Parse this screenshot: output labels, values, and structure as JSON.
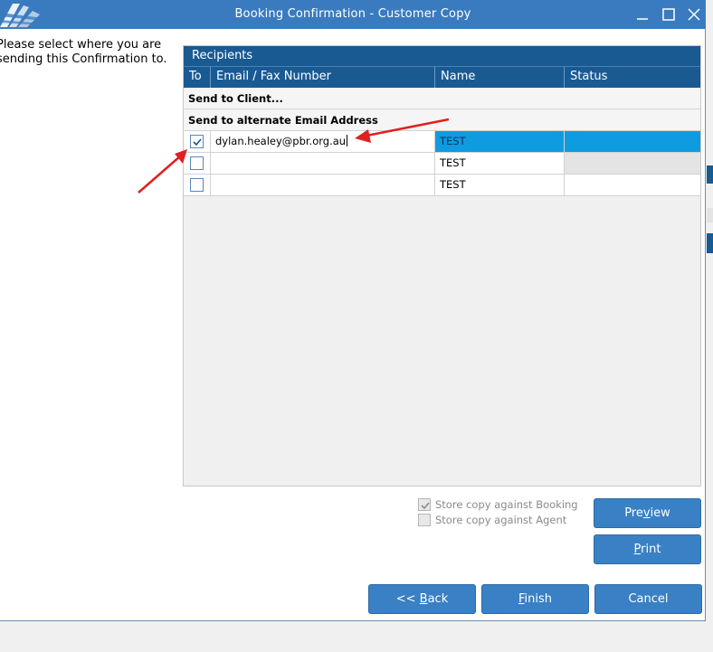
{
  "window": {
    "title": "Booking Confirmation - Customer Copy"
  },
  "instruction": {
    "line1": "Please select where you are",
    "line2": "sending this Confirmation to."
  },
  "recipients": {
    "title": "Recipients",
    "columns": {
      "to": "To",
      "email": "Email / Fax Number",
      "name": "Name",
      "status": "Status"
    },
    "groups": {
      "client": "Send to Client...",
      "alternate": "Send to alternate Email Address"
    },
    "rows": [
      {
        "checked": true,
        "email": "dylan.healey@pbr.org.au",
        "name": "TEST",
        "status": ""
      },
      {
        "checked": false,
        "email": "",
        "name": "TEST",
        "status": ""
      },
      {
        "checked": false,
        "email": "",
        "name": "TEST",
        "status": ""
      }
    ]
  },
  "options": {
    "store_booking": {
      "label": "Store copy against Booking",
      "checked": true
    },
    "store_agent": {
      "label": "Store copy against Agent",
      "checked": false
    }
  },
  "buttons": {
    "preview": {
      "pre": "Pre",
      "key": "v",
      "post": "iew"
    },
    "print": {
      "pre": "",
      "key": "P",
      "post": "rint"
    },
    "back": {
      "pre": "<< ",
      "key": "B",
      "post": "ack"
    },
    "finish": {
      "pre": "",
      "key": "F",
      "post": "inish"
    },
    "cancel": {
      "pre": "Cancel",
      "key": "",
      "post": ""
    }
  },
  "colors": {
    "titlebar": "#3a7bbf",
    "header": "#195a93",
    "selection": "#0f9be0",
    "button": "#3a80c4",
    "annotation_arrow": "#e02020"
  }
}
